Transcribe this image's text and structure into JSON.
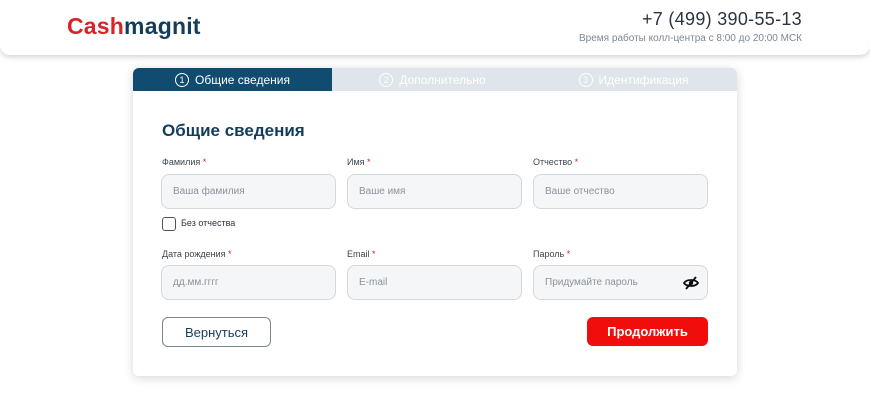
{
  "header": {
    "logo_part1": "Cash",
    "logo_part2": "magnit",
    "phone": "+7 (499) 390-55-13",
    "hours": "Время работы колл-центра с 8:00 до 20:00 МСК"
  },
  "steps": [
    {
      "num": "1",
      "label": "Общие сведения",
      "active": true
    },
    {
      "num": "2",
      "label": "Дополнительно",
      "active": false
    },
    {
      "num": "3",
      "label": "Идентификация",
      "active": false
    }
  ],
  "form": {
    "title": "Общие сведения",
    "required_mark": "*",
    "fields": {
      "lastname": {
        "label": "Фамилия",
        "placeholder": "Ваша фамилия"
      },
      "firstname": {
        "label": "Имя",
        "placeholder": "Ваше имя"
      },
      "patronymic": {
        "label": "Отчество",
        "placeholder": "Ваше отчество"
      },
      "birthdate": {
        "label": "Дата рождения",
        "placeholder": "дд.мм.гггг"
      },
      "email": {
        "label": "Email",
        "placeholder": "E-mail"
      },
      "password": {
        "label": "Пароль",
        "placeholder": "Придумайте пароль"
      }
    },
    "no_patronymic_label": "Без отчества",
    "back_label": "Вернуться",
    "next_label": "Продолжить"
  },
  "colors": {
    "brand_red": "#d8232a",
    "brand_blue": "#143d5c",
    "active_tab": "#0f4c70",
    "button_red": "#f20d0d"
  },
  "icons": {
    "password_toggle": "eye-slash-icon",
    "step_number": "circle-number-icon"
  }
}
